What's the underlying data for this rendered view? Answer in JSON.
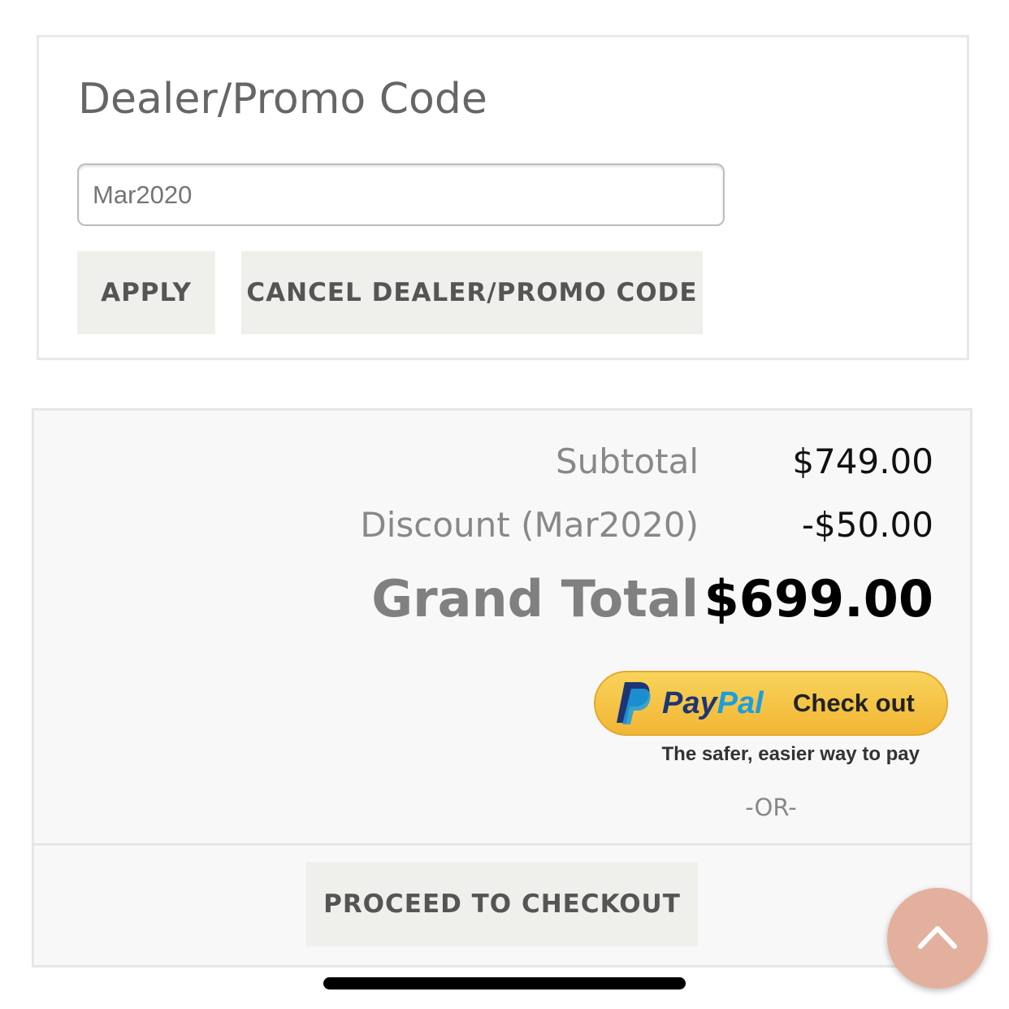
{
  "promo": {
    "title": "Dealer/Promo Code",
    "input_value": "Mar2020",
    "apply_label": "APPLY",
    "cancel_label": "CANCEL DEALER/PROMO CODE"
  },
  "totals": {
    "subtotal_label": "Subtotal",
    "subtotal_value": "$749.00",
    "discount_label": "Discount (Mar2020)",
    "discount_value": "-$50.00",
    "grand_total_label": "Grand Total",
    "grand_total_value": "$699.00"
  },
  "paypal": {
    "pay": "Pay",
    "pal": "Pal",
    "checkout": "Check out",
    "tagline": "The safer, easier way to pay",
    "colors": {
      "button": "#f5c244",
      "pay": "#1d3574",
      "pal": "#1b9ee0"
    }
  },
  "or_text": "-OR-",
  "checkout_label": "PROCEED TO CHECKOUT",
  "back_to_top": {
    "icon": "chevron-up-icon",
    "color": "#e1aa96"
  }
}
